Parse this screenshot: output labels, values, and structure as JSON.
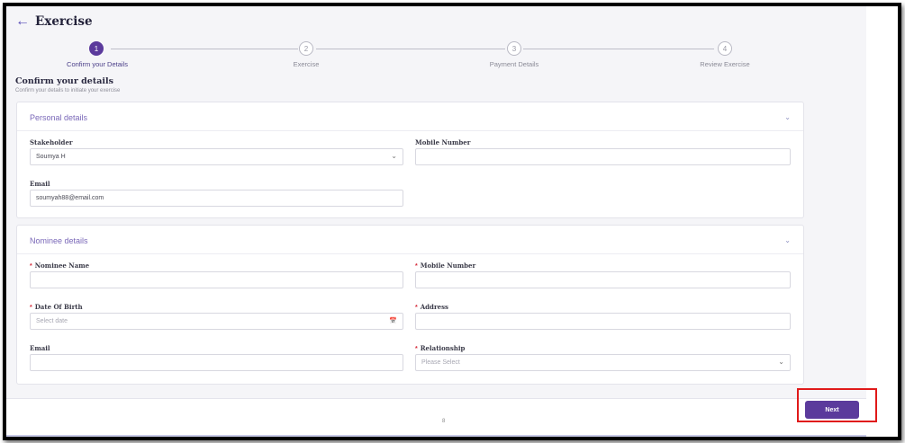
{
  "header": {
    "back_icon": "arrow-left-icon",
    "title": "Exercise"
  },
  "stepper": {
    "steps": [
      {
        "number": "1",
        "label": "Confirm your Details",
        "active": true
      },
      {
        "number": "2",
        "label": "Exercise",
        "active": false
      },
      {
        "number": "3",
        "label": "Payment Details",
        "active": false
      },
      {
        "number": "4",
        "label": "Review Exercise",
        "active": false
      }
    ]
  },
  "confirm": {
    "title": "Confirm your details",
    "subtitle": "Confirm your details to initiate your exercise"
  },
  "personal": {
    "title": "Personal details",
    "stakeholder_label": "Stakeholder",
    "stakeholder_value": "Soumya H",
    "mobile_label": "Mobile Number",
    "mobile_value": "",
    "email_label": "Email",
    "email_value": "soumyah88@email.com"
  },
  "nominee": {
    "title": "Nominee details",
    "name_label": "Nominee Name",
    "mobile_label": "Mobile Number",
    "dob_label": "Date Of Birth",
    "dob_placeholder": "Select date",
    "address_label": "Address",
    "email_label": "Email",
    "relationship_label": "Relationship",
    "relationship_placeholder": "Please Select",
    "required_marker": "*"
  },
  "footer": {
    "next_label": "Next",
    "page_indicator": "8"
  },
  "colors": {
    "accent": "#5b3a9c",
    "highlight": "#e01a1a",
    "required": "#d62b3a"
  }
}
